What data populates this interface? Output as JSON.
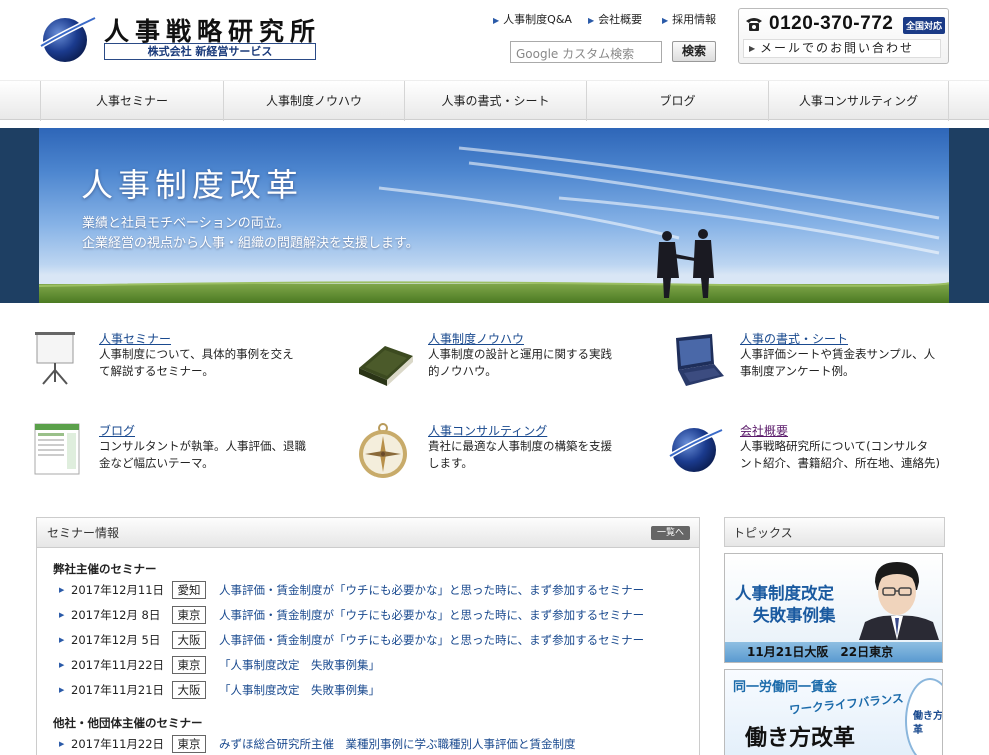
{
  "header": {
    "site_title": "人事戦略研究所",
    "company": "株式会社 新経営サービス",
    "util_links": [
      "人事制度Q&A",
      "会社概要",
      "採用情報"
    ],
    "search_placeholder": "Google カスタム検索",
    "search_button": "検索",
    "phone": "0120-370-772",
    "nationwide_badge": "全国対応",
    "mail_contact": "メールでのお問い合わせ"
  },
  "nav": {
    "items": [
      "人事セミナー",
      "人事制度ノウハウ",
      "人事の書式・シート",
      "ブログ",
      "人事コンサルティング"
    ]
  },
  "hero": {
    "title": "人事制度改革",
    "sub1": "業績と社員モチベーションの両立。",
    "sub2": "企業経営の視点から人事・組織の問題解決を支援します。"
  },
  "services": [
    {
      "title": "人事セミナー",
      "desc1": "人事制度について、具体的事例を交え",
      "desc2": "て解説するセミナー。",
      "icon": "projector-screen-icon"
    },
    {
      "title": "人事制度ノウハウ",
      "desc1": "人事制度の設計と運用に関する実践",
      "desc2": "的ノウハウ。",
      "icon": "book-icon"
    },
    {
      "title": "人事の書式・シート",
      "desc1": "人事評価シートや賃金表サンプル、人",
      "desc2": "事制度アンケート例。",
      "icon": "laptop-icon"
    },
    {
      "title": "ブログ",
      "desc1": "コンサルタントが執筆。人事評価、退職",
      "desc2": "金など幅広いテーマ。",
      "icon": "blog-page-icon"
    },
    {
      "title": "人事コンサルティング",
      "desc1": "貴社に最適な人事制度の構築を支援",
      "desc2": "します。",
      "icon": "compass-icon"
    },
    {
      "title": "会社概要",
      "desc1": "人事戦略研究所について(コンサルタ",
      "desc2": "ント紹介、書籍紹介、所在地、連絡先)",
      "icon": "globe-logo-icon"
    }
  ],
  "seminar": {
    "heading": "セミナー情報",
    "more": "一覧へ",
    "own_heading": "弊社主催のセミナー",
    "own": [
      {
        "date": "2017年12月11日",
        "place": "愛知",
        "title": "人事評価・賃金制度が「ウチにも必要かな」と思った時に、まず参加するセミナー"
      },
      {
        "date": "2017年12月 8日",
        "place": "東京",
        "title": "人事評価・賃金制度が「ウチにも必要かな」と思った時に、まず参加するセミナー"
      },
      {
        "date": "2017年12月 5日",
        "place": "大阪",
        "title": "人事評価・賃金制度が「ウチにも必要かな」と思った時に、まず参加するセミナー"
      },
      {
        "date": "2017年11月22日",
        "place": "東京",
        "title": "「人事制度改定　失敗事例集」"
      },
      {
        "date": "2017年11月21日",
        "place": "大阪",
        "title": "「人事制度改定　失敗事例集」"
      }
    ],
    "other_heading": "他社・他団体主催のセミナー",
    "other": [
      {
        "date": "2017年11月22日",
        "place": "東京",
        "title": "みずほ総合研究所主催　業種別事例に学ぶ職種別人事評価と賃金制度"
      }
    ]
  },
  "topics": {
    "heading": "トピックス",
    "banner1": {
      "line1": "人事制度改定",
      "line2": "失敗事例集",
      "foot": "11月21日大阪　22日東京"
    },
    "banner2": {
      "line1": "同一労働同一賃金",
      "line2": "ワークライフバランス",
      "line3": "働き方改革",
      "side": "働き方改革"
    }
  },
  "colors": {
    "link": "#1a4a8f",
    "hero_bg": "#1e3f63",
    "brand_navy": "#1a3a86"
  }
}
